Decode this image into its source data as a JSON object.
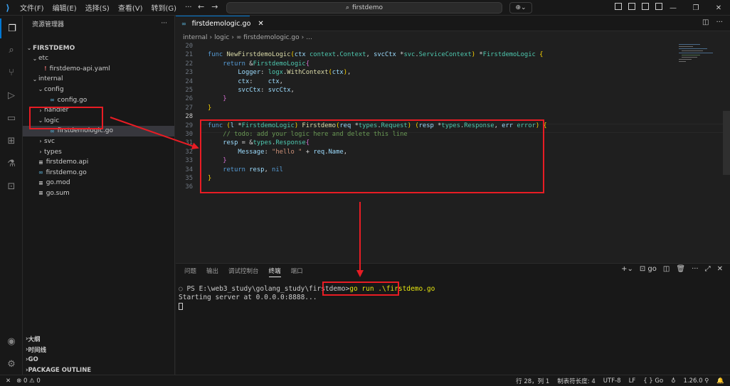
{
  "titlebar": {
    "menu": [
      "文件(F)",
      "编辑(E)",
      "选择(S)",
      "查看(V)",
      "转到(G)",
      "···"
    ],
    "search": "firstdemo",
    "copilot": "⌄"
  },
  "sidebar": {
    "title": "资源管理器",
    "more": "···",
    "tree": [
      {
        "label": "FIRSTDEMO",
        "twisty": "⌄",
        "icon": "",
        "indent": 0,
        "bold": true
      },
      {
        "label": "etc",
        "twisty": "⌄",
        "icon": "",
        "indent": 1
      },
      {
        "label": "firstdemo-api.yaml",
        "twisty": "",
        "icon": "!",
        "iconType": "yaml",
        "indent": 2
      },
      {
        "label": "internal",
        "twisty": "⌄",
        "icon": "",
        "indent": 1
      },
      {
        "label": "config",
        "twisty": "⌄",
        "icon": "",
        "indent": 2
      },
      {
        "label": "config.go",
        "twisty": "",
        "icon": "∞",
        "iconType": "go",
        "indent": 3
      },
      {
        "label": "handler",
        "twisty": "›",
        "icon": "",
        "indent": 2
      },
      {
        "label": "logic",
        "twisty": "⌄",
        "icon": "",
        "indent": 2
      },
      {
        "label": "firstdemologic.go",
        "twisty": "",
        "icon": "∞",
        "iconType": "go",
        "indent": 3,
        "selected": true
      },
      {
        "label": "svc",
        "twisty": "›",
        "icon": "",
        "indent": 2
      },
      {
        "label": "types",
        "twisty": "›",
        "icon": "",
        "indent": 2
      },
      {
        "label": "firstdemo.api",
        "twisty": "",
        "icon": "≡",
        "iconType": "api",
        "indent": 1
      },
      {
        "label": "firstdemo.go",
        "twisty": "",
        "icon": "∞",
        "iconType": "go",
        "indent": 1
      },
      {
        "label": "go.mod",
        "twisty": "",
        "icon": "≡",
        "iconType": "api",
        "indent": 1
      },
      {
        "label": "go.sum",
        "twisty": "",
        "icon": "≡",
        "iconType": "api",
        "indent": 1
      }
    ],
    "sections": [
      "大纲",
      "时间线",
      "GO",
      "PACKAGE OUTLINE"
    ]
  },
  "editor": {
    "tab": "firstdemologic.go",
    "breadcrumb": [
      "internal",
      "›",
      "logic",
      "›",
      "∞ firstdemologic.go",
      "›",
      "..."
    ],
    "lines": [
      {
        "n": "20",
        "html": ""
      },
      {
        "n": "21",
        "html": "<span class='kw'>func</span> <span class='fn'>NewFirstdemoLogic</span><span class='br1'>(</span><span class='id'>ctx</span> <span class='ty'>context</span>.<span class='ty'>Context</span>, <span class='id'>svcCtx</span> *<span class='ty'>svc</span>.<span class='ty'>ServiceContext</span><span class='br1'>)</span> *<span class='ty'>FirstdemoLogic</span> <span class='br1'>{</span>"
      },
      {
        "n": "22",
        "html": "    <span class='kw'>return</span> &amp;<span class='ty'>FirstdemoLogic</span><span class='br2'>{</span>"
      },
      {
        "n": "23",
        "html": "        <span class='id'>Logger</span>: <span class='ty'>logx</span>.<span class='fn'>WithContext</span><span class='br1'>(</span><span class='id'>ctx</span><span class='br1'>)</span>,"
      },
      {
        "n": "24",
        "html": "        <span class='id'>ctx</span>:    <span class='id'>ctx</span>,"
      },
      {
        "n": "25",
        "html": "        <span class='id'>svcCtx</span>: <span class='id'>svcCtx</span>,"
      },
      {
        "n": "26",
        "html": "    <span class='br2'>}</span>"
      },
      {
        "n": "27",
        "html": "<span class='br1'>}</span>"
      },
      {
        "n": "28",
        "html": "",
        "cur": true
      },
      {
        "n": "29",
        "html": "<span class='kw'>func</span> <span class='br1'>(</span><span class='id'>l</span> *<span class='ty'>FirstdemoLogic</span><span class='br1'>)</span> <span class='fn'>Firstdemo</span><span class='br1'>(</span><span class='id'>req</span> *<span class='ty'>types</span>.<span class='ty'>Request</span><span class='br1'>)</span> <span class='br1'>(</span><span class='id'>resp</span> *<span class='ty'>types</span>.<span class='ty'>Response</span>, <span class='id'>err</span> <span class='ty'>error</span><span class='br1'>)</span> <span class='br1'>{</span>"
      },
      {
        "n": "30",
        "html": "    <span class='cm'>// todo: add your logic here and delete this line</span>"
      },
      {
        "n": "31",
        "html": "    <span class='id'>resp</span> = &amp;<span class='ty'>types</span>.<span class='ty'>Response</span><span class='br2'>{</span>"
      },
      {
        "n": "32",
        "html": "        <span class='id'>Message</span>: <span class='str'>\"hello \"</span> + <span class='id'>req</span>.<span class='id'>Name</span>,"
      },
      {
        "n": "33",
        "html": "    <span class='br2'>}</span>"
      },
      {
        "n": "34",
        "html": "    <span class='kw'>return</span> <span class='id'>resp</span>, <span class='kw'>nil</span>"
      },
      {
        "n": "35",
        "html": "<span class='br1'>}</span>"
      },
      {
        "n": "36",
        "html": ""
      }
    ]
  },
  "panel": {
    "tabs": [
      "问题",
      "输出",
      "调试控制台",
      "终端",
      "端口"
    ],
    "active_tab": "终端",
    "actions": [
      "+⌄",
      "⊡ go",
      "◫",
      "🗑",
      "···",
      "⤢",
      "✕"
    ],
    "terminal": {
      "prompt": "PS E:\\web3_study\\golang_study\\firstdemo>",
      "command": "go run .\\firstdemo.go",
      "output": "Starting server at 0.0.0.0:8888..."
    }
  },
  "statusbar": {
    "left": [
      "✕",
      "⊗ 0 ⚠ 0"
    ],
    "right": [
      "行 28，列 1",
      "制表符长度: 4",
      "UTF-8",
      "LF",
      "{ } Go",
      "♁",
      "1.26.0 ⚲",
      "🔔"
    ]
  },
  "colors": {
    "annotation": "#e81c24",
    "accent": "#0078d4"
  }
}
